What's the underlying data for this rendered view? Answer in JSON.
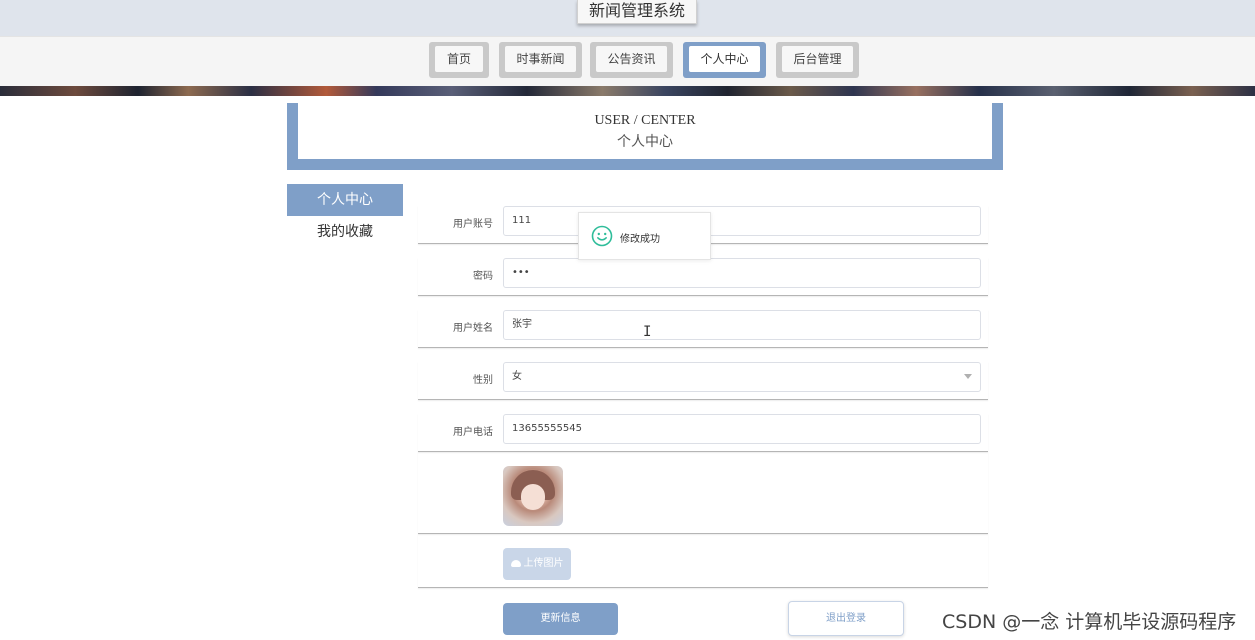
{
  "site": {
    "title": "新闻管理系统"
  },
  "nav": {
    "items": [
      {
        "label": "首页"
      },
      {
        "label": "时事新闻"
      },
      {
        "label": "公告资讯"
      },
      {
        "label": "个人中心"
      },
      {
        "label": "后台管理"
      }
    ],
    "active_index": 3
  },
  "user_center": {
    "title_en": "USER / CENTER",
    "title_cn": "个人中心"
  },
  "sidebar": {
    "items": [
      {
        "label": "个人中心"
      },
      {
        "label": "我的收藏"
      }
    ]
  },
  "form": {
    "account": {
      "label": "用户账号",
      "value": "111"
    },
    "password": {
      "label": "密码",
      "value": "•••"
    },
    "name": {
      "label": "用户姓名",
      "value": "张宇"
    },
    "gender": {
      "label": "性别",
      "value": "女"
    },
    "phone": {
      "label": "用户电话",
      "value": "13655555545"
    }
  },
  "upload": {
    "label": "上传图片",
    "icon": "cloud-upload-icon"
  },
  "actions": {
    "update_label": "更新信息",
    "logout_label": "退出登录"
  },
  "toast": {
    "message": "修改成功",
    "icon": "smile-icon",
    "color": "#2fbd9a"
  },
  "colors": {
    "accent": "#7f9fc8"
  },
  "watermark": "CSDN @一念 计算机毕设源码程序"
}
